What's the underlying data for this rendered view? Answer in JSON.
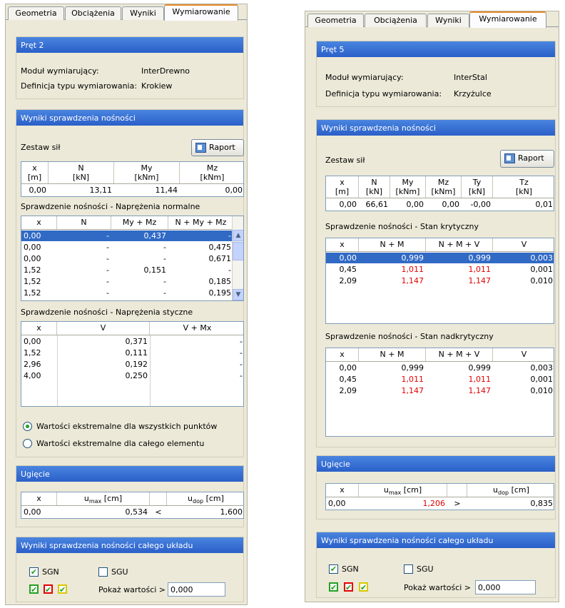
{
  "tabs": [
    "Geometria",
    "Obciążenia",
    "Wyniki",
    "Wymiarowanie"
  ],
  "left": {
    "bar_title": "Pręt 2",
    "module_label": "Moduł wymiarujący:",
    "module_value": "InterDrewno",
    "def_label": "Definicja typu wymiarowania:",
    "def_value": "Krokiew",
    "results_title": "Wyniki sprawdzenia nośności",
    "forces_label": "Zestaw sił",
    "report_button": "Raport",
    "forces_headers": [
      "x\n[m]",
      "N\n[kN]",
      "My\n[kNm]",
      "Mz\n[kNm]"
    ],
    "forces_row": [
      "0,00",
      "13,11",
      "11,44",
      "0,00"
    ],
    "normal_title": "Sprawdzenie nośności - Naprężenia normalne",
    "normal_headers": [
      "x",
      "N",
      "My + Mz",
      "N + My + Mz"
    ],
    "normal_rows": [
      [
        "0,00",
        "-",
        "0,437",
        "-"
      ],
      [
        "0,00",
        "-",
        "-",
        "0,475"
      ],
      [
        "0,00",
        "-",
        "-",
        "0,671"
      ],
      [
        "1,52",
        "-",
        "0,151",
        "-"
      ],
      [
        "1,52",
        "-",
        "-",
        "0,185"
      ],
      [
        "1,52",
        "-",
        "-",
        "0,195"
      ]
    ],
    "shear_title": "Sprawdzenie nośności - Naprężenia styczne",
    "shear_headers": [
      "x",
      "V",
      "V + Mx"
    ],
    "shear_rows": [
      [
        "0,00",
        "0,371",
        "-"
      ],
      [
        "1,52",
        "0,111",
        "-"
      ],
      [
        "2,96",
        "0,192",
        "-"
      ],
      [
        "4,00",
        "0,250",
        "-"
      ]
    ],
    "radio_all": "Wartości ekstremalne dla wszystkich punktów",
    "radio_elem": "Wartości ekstremalne dla całego elementu",
    "defl_title": "Ugięcie",
    "defl_headers": {
      "x": "x",
      "umax": "u",
      "umax_sub": "max",
      "umax_unit": " [cm]",
      "udop": "u",
      "udop_sub": "dop",
      "udop_unit": " [cm]"
    },
    "defl_row": [
      "0,00",
      "0,534",
      "<",
      "1,600"
    ],
    "system_title": "Wyniki sprawdzenia nośności całego układu",
    "sgn": "SGN",
    "sgu": "SGU",
    "show_values_label": "Pokaż wartości >",
    "show_values_value": "0,000"
  },
  "right": {
    "bar_title": "Pręt 5",
    "module_label": "Moduł wymiarujący:",
    "module_value": "InterStal",
    "def_label": "Definicja typu wymiarowania:",
    "def_value": "Krzyżulce",
    "results_title": "Wyniki sprawdzenia nośności",
    "forces_label": "Zestaw sił",
    "report_button": "Raport",
    "forces_headers": [
      "x\n[m]",
      "N\n[kN]",
      "My\n[kNm]",
      "Mz\n[kNm]",
      "Ty\n[kN]",
      "Tz\n[kN]"
    ],
    "forces_row": [
      "0,00",
      "66,61",
      "0,00",
      "0,00",
      "-0,00",
      "0,01"
    ],
    "crit_title": "Sprawdzenie nośności - Stan krytyczny",
    "crit_headers": [
      "x",
      "N + M",
      "N + M + V",
      "V"
    ],
    "crit_rows": [
      [
        "0,00",
        "0,999",
        "0,999",
        "0,003"
      ],
      [
        "0,45",
        "1,011",
        "1,011",
        "0,001"
      ],
      [
        "2,09",
        "1,147",
        "1,147",
        "0,010"
      ]
    ],
    "post_title": "Sprawdzenie nośności - Stan nadkrytyczny",
    "post_headers": [
      "x",
      "N + M",
      "N + M + V",
      "V"
    ],
    "post_rows": [
      [
        "0,00",
        "0,999",
        "0,999",
        "0,003"
      ],
      [
        "0,45",
        "1,011",
        "1,011",
        "0,001"
      ],
      [
        "2,09",
        "1,147",
        "1,147",
        "0,010"
      ]
    ],
    "defl_title": "Ugięcie",
    "defl_headers": {
      "x": "x",
      "umax": "u",
      "umax_sub": "max",
      "umax_unit": " [cm]",
      "udop": "u",
      "udop_sub": "dop",
      "udop_unit": " [cm]"
    },
    "defl_row": [
      "0,00",
      "1,206",
      ">",
      "0,835"
    ],
    "system_title": "Wyniki sprawdzenia nośności całego układu",
    "sgn": "SGN",
    "sgu": "SGU",
    "show_values_label": "Pokaż wartości >",
    "show_values_value": "0,000"
  },
  "colors": {
    "header_blue": "#2a5fc8",
    "selection": "#316ac5",
    "exceed_red": "#e00000",
    "check_green": "#21a121",
    "panel_bg": "#ece9d8"
  }
}
